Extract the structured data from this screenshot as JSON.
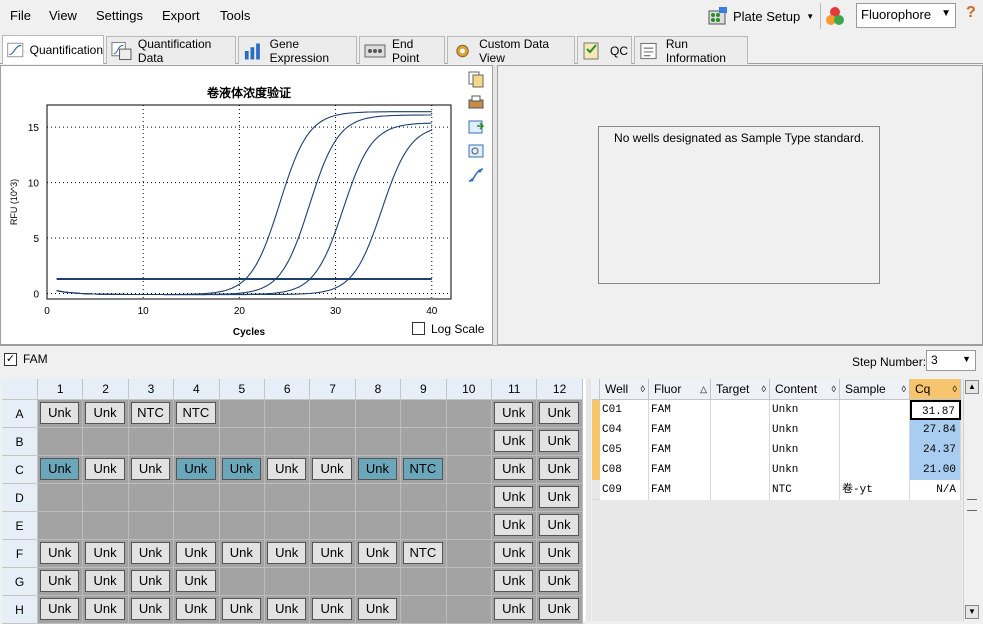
{
  "menu": {
    "file": "File",
    "view": "View",
    "settings": "Settings",
    "export": "Export",
    "tools": "Tools"
  },
  "toolbar": {
    "plate_setup": "Plate Setup",
    "fluorophore": "Fluorophore"
  },
  "tabs": [
    "Quantification",
    "Quantification Data",
    "Gene Expression",
    "End Point",
    "Custom Data View",
    "QC",
    "Run Information"
  ],
  "chart_data": {
    "type": "line",
    "title": "卷液体浓度验证",
    "xlabel": "Cycles",
    "ylabel": "RFU (10^3)",
    "xlim": [
      0,
      42
    ],
    "ylim": [
      -0.5,
      17
    ],
    "x_ticks": [
      "0",
      "10",
      "20",
      "30",
      "40"
    ],
    "y_ticks": [
      "0",
      "5",
      "10",
      "15"
    ],
    "grid": "dotted",
    "log_scale_label": "Log Scale",
    "log_scale": false,
    "series": [
      {
        "midpoint": 24.2,
        "plateau": 16.5
      },
      {
        "midpoint": 27.3,
        "plateau": 16.2
      },
      {
        "midpoint": 30.8,
        "plateau": 15.5
      },
      {
        "midpoint": 34.8,
        "plateau": 15.3
      },
      {
        "flat": 1.3
      }
    ]
  },
  "std_message": "No wells designated as Sample Type standard.",
  "fam": {
    "label": "FAM",
    "checked": "✓"
  },
  "step": {
    "label": "Step Number:",
    "value": "3"
  },
  "plate": {
    "cols": [
      "1",
      "2",
      "3",
      "4",
      "5",
      "6",
      "7",
      "8",
      "9",
      "10",
      "11",
      "12"
    ],
    "rows": [
      {
        "label": "A",
        "cells": [
          "Unk",
          "Unk",
          "NTC",
          "NTC",
          "",
          "",
          "",
          "",
          "",
          "",
          "Unk",
          "Unk"
        ],
        "sel": []
      },
      {
        "label": "B",
        "cells": [
          "",
          "",
          "",
          "",
          "",
          "",
          "",
          "",
          "",
          "",
          "Unk",
          "Unk"
        ],
        "sel": []
      },
      {
        "label": "C",
        "cells": [
          "Unk",
          "Unk",
          "Unk",
          "Unk",
          "Unk",
          "Unk",
          "Unk",
          "Unk",
          "NTC",
          "",
          "Unk",
          "Unk"
        ],
        "sel": [
          0,
          3,
          4,
          7,
          8
        ]
      },
      {
        "label": "D",
        "cells": [
          "",
          "",
          "",
          "",
          "",
          "",
          "",
          "",
          "",
          "",
          "Unk",
          "Unk"
        ],
        "sel": []
      },
      {
        "label": "E",
        "cells": [
          "",
          "",
          "",
          "",
          "",
          "",
          "",
          "",
          "",
          "",
          "Unk",
          "Unk"
        ],
        "sel": []
      },
      {
        "label": "F",
        "cells": [
          "Unk",
          "Unk",
          "Unk",
          "Unk",
          "Unk",
          "Unk",
          "Unk",
          "Unk",
          "NTC",
          "",
          "Unk",
          "Unk"
        ],
        "sel": []
      },
      {
        "label": "G",
        "cells": [
          "Unk",
          "Unk",
          "Unk",
          "Unk",
          "",
          "",
          "",
          "",
          "",
          "",
          "Unk",
          "Unk"
        ],
        "sel": []
      },
      {
        "label": "H",
        "cells": [
          "Unk",
          "Unk",
          "Unk",
          "Unk",
          "Unk",
          "Unk",
          "Unk",
          "Unk",
          "",
          "",
          "Unk",
          "Unk"
        ],
        "sel": []
      }
    ]
  },
  "table": {
    "headers": [
      "Well",
      "Fluor",
      "Target",
      "Content",
      "Sample",
      "Cq"
    ],
    "rows": [
      {
        "well": "C01",
        "fluor": "FAM",
        "target": "",
        "content": "Unkn",
        "sample": "",
        "cq": "31.87"
      },
      {
        "well": "C04",
        "fluor": "FAM",
        "target": "",
        "content": "Unkn",
        "sample": "",
        "cq": "27.84"
      },
      {
        "well": "C05",
        "fluor": "FAM",
        "target": "",
        "content": "Unkn",
        "sample": "",
        "cq": "24.37"
      },
      {
        "well": "C08",
        "fluor": "FAM",
        "target": "",
        "content": "Unkn",
        "sample": "",
        "cq": "21.00"
      },
      {
        "well": "C09",
        "fluor": "FAM",
        "target": "",
        "content": "NTC",
        "sample": "卷-yt",
        "cq": "N/A"
      }
    ]
  }
}
